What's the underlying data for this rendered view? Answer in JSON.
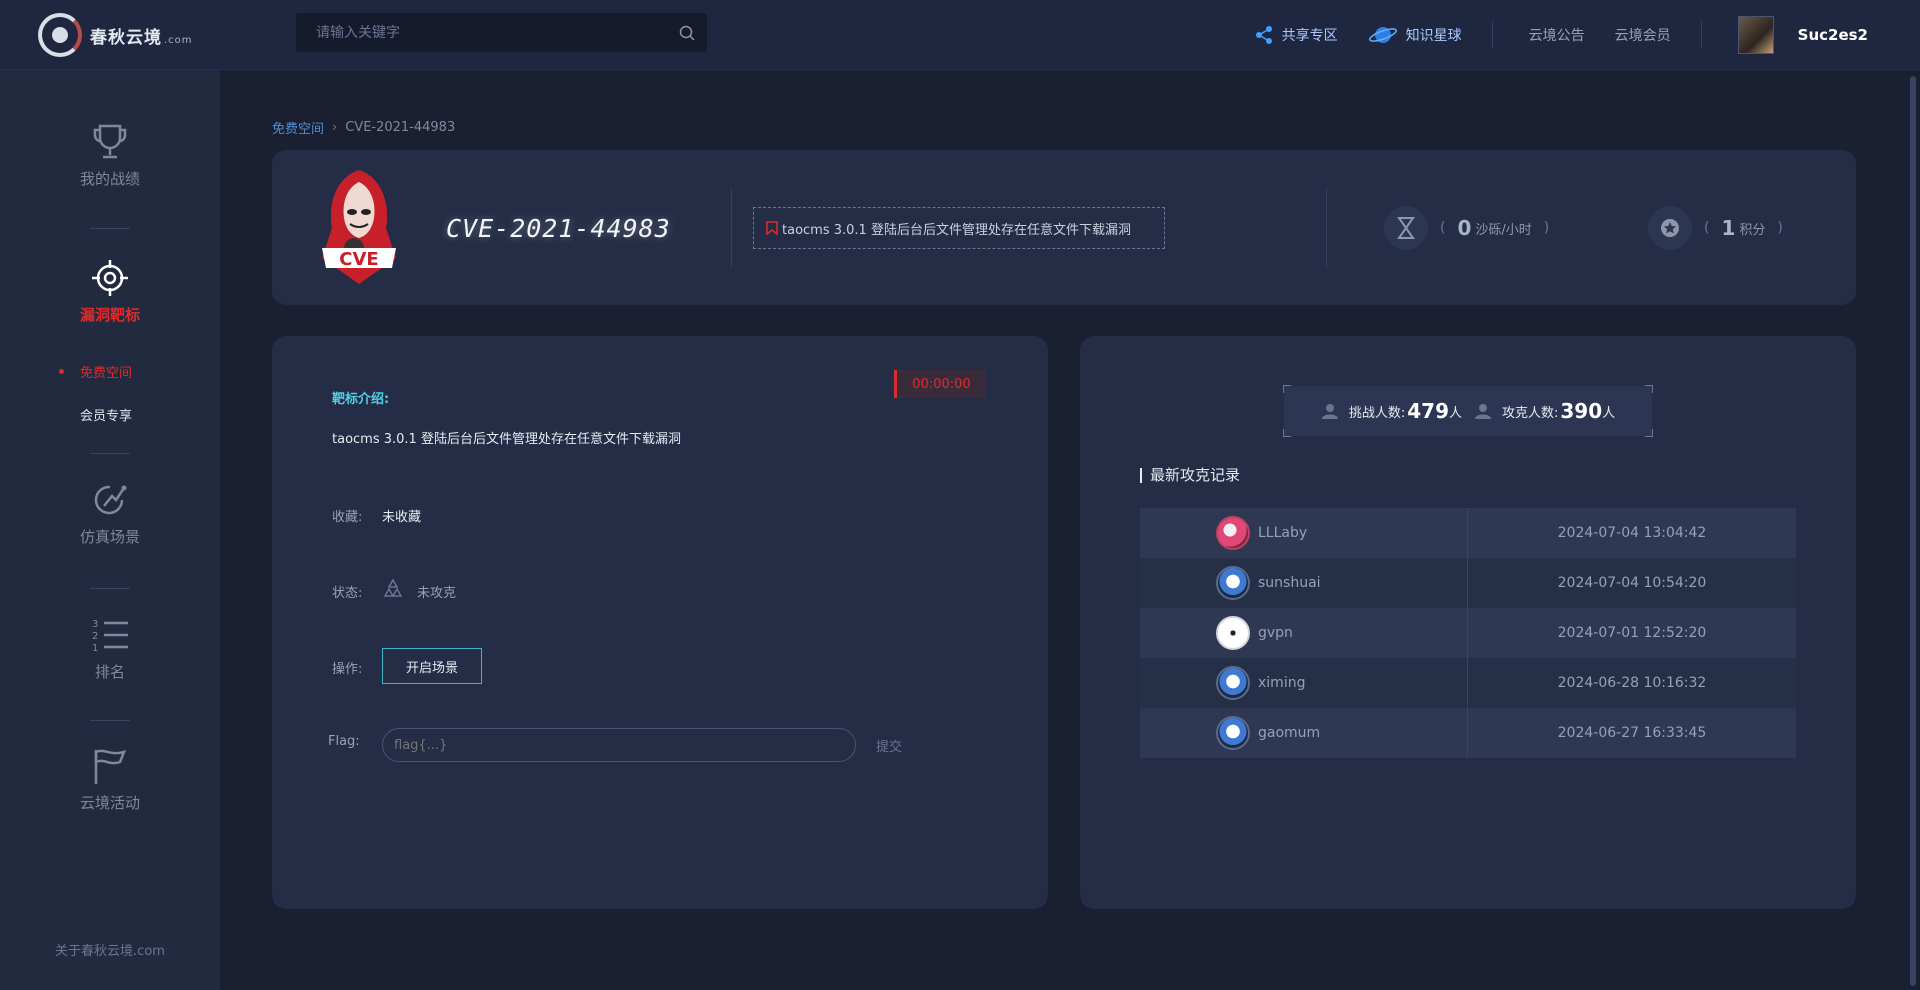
{
  "header": {
    "brand": "春秋云境",
    "brand_suffix": ".com",
    "search_placeholder": "请输入关键字",
    "nav": [
      {
        "label": "共享专区",
        "icon": "share-icon"
      },
      {
        "label": "知识星球",
        "icon": "planet-icon"
      }
    ],
    "links": [
      "云境公告",
      "云境会员"
    ],
    "username": "Suc2es2"
  },
  "sidebar": {
    "items": [
      {
        "label": "我的战绩",
        "icon": "trophy-icon"
      },
      {
        "label": "漏洞靶标",
        "icon": "target-icon",
        "active": true
      },
      {
        "label": "仿真场景",
        "icon": "scene-icon"
      },
      {
        "label": "排名",
        "icon": "ranking-icon"
      },
      {
        "label": "云境活动",
        "icon": "flag-icon"
      }
    ],
    "sub_items": [
      {
        "label": "免费空间",
        "active": true
      },
      {
        "label": "会员专享"
      }
    ],
    "about": "关于春秋云境.com"
  },
  "breadcrumb": {
    "parent": "免费空间",
    "current": "CVE-2021-44983"
  },
  "hero": {
    "badge_text": "CVE",
    "title": "CVE-2021-44983",
    "description": "taocms 3.0.1 登陆后台后文件管理处存在任意文件下载漏洞",
    "stat1": {
      "value": "0",
      "unit": "沙砾/小时",
      "icon": "hourglass-icon"
    },
    "stat2": {
      "value": "1",
      "unit": "积分",
      "icon": "medal-icon"
    },
    "paren_open": "(",
    "paren_close": ")"
  },
  "detail": {
    "timer": "00:00:00",
    "intro_label": "靶标介绍:",
    "intro_text": "taocms 3.0.1 登陆后台后文件管理处存在任意文件下载漏洞",
    "favorite_label": "收藏:",
    "favorite_value": "未收藏",
    "status_label": "状态:",
    "status_value": "未攻克",
    "action_label": "操作:",
    "start_button": "开启场景",
    "flag_label": "Flag:",
    "flag_placeholder": "flag{...}",
    "submit_label": "提交"
  },
  "stats": {
    "challengers_label": "挑战人数:",
    "challengers_value": "479",
    "challengers_unit": "人",
    "solvers_label": "攻克人数:",
    "solvers_value": "390",
    "solvers_unit": "人"
  },
  "records": {
    "title": "最新攻克记录",
    "rows": [
      {
        "user": "LLLaby",
        "time": "2024-07-04 13:04:42",
        "avatar": "pink"
      },
      {
        "user": "sunshuai",
        "time": "2024-07-04 10:54:20",
        "avatar": "blue"
      },
      {
        "user": "gvpn",
        "time": "2024-07-01 12:52:20",
        "avatar": "white"
      },
      {
        "user": "ximing",
        "time": "2024-06-28 10:16:32",
        "avatar": "blue"
      },
      {
        "user": "gaomum",
        "time": "2024-06-27 16:33:45",
        "avatar": "blue"
      }
    ]
  },
  "colors": {
    "accent_red": "#e02a2a",
    "accent_cyan": "#4fd0e8",
    "link_blue": "#a8c8ff",
    "background": "#1a2032",
    "card": "#242d45"
  }
}
